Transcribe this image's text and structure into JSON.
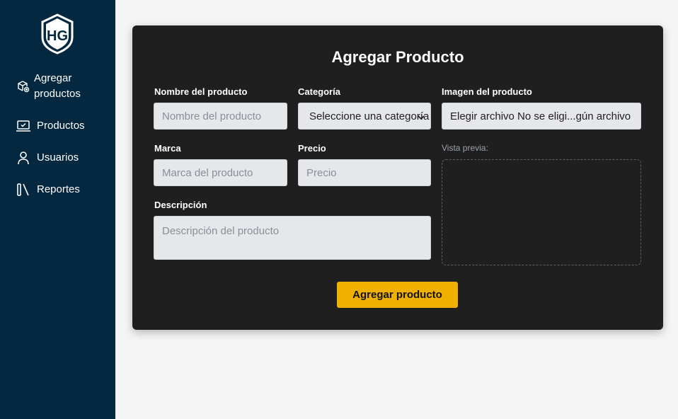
{
  "sidebar": {
    "logo_text": "HG",
    "items": [
      {
        "label": "Agregar productos",
        "icon": "box-add-icon"
      },
      {
        "label": "Productos",
        "icon": "laptop-check-icon"
      },
      {
        "label": "Usuarios",
        "icon": "user-icon"
      },
      {
        "label": "Reportes",
        "icon": "books-icon"
      }
    ],
    "background": "#04283f"
  },
  "form": {
    "title": "Agregar Producto",
    "nombre": {
      "label": "Nombre del producto",
      "placeholder": "Nombre del producto"
    },
    "categoria": {
      "label": "Categoría",
      "selected": "Seleccione una categoría"
    },
    "imagen": {
      "label": "Imagen del producto",
      "value": "Elegir archivo No se eligi...gún archivo"
    },
    "marca": {
      "label": "Marca",
      "placeholder": "Marca del producto"
    },
    "precio": {
      "label": "Precio",
      "placeholder": "Precio"
    },
    "descripcion": {
      "label": "Descripción",
      "placeholder": "Descripción del producto"
    },
    "preview_label": "Vista previa:",
    "submit_label": "Agregar producto"
  },
  "colors": {
    "card": "#1f1f1f",
    "accent": "#f0b000",
    "page": "#f5f5f5"
  }
}
